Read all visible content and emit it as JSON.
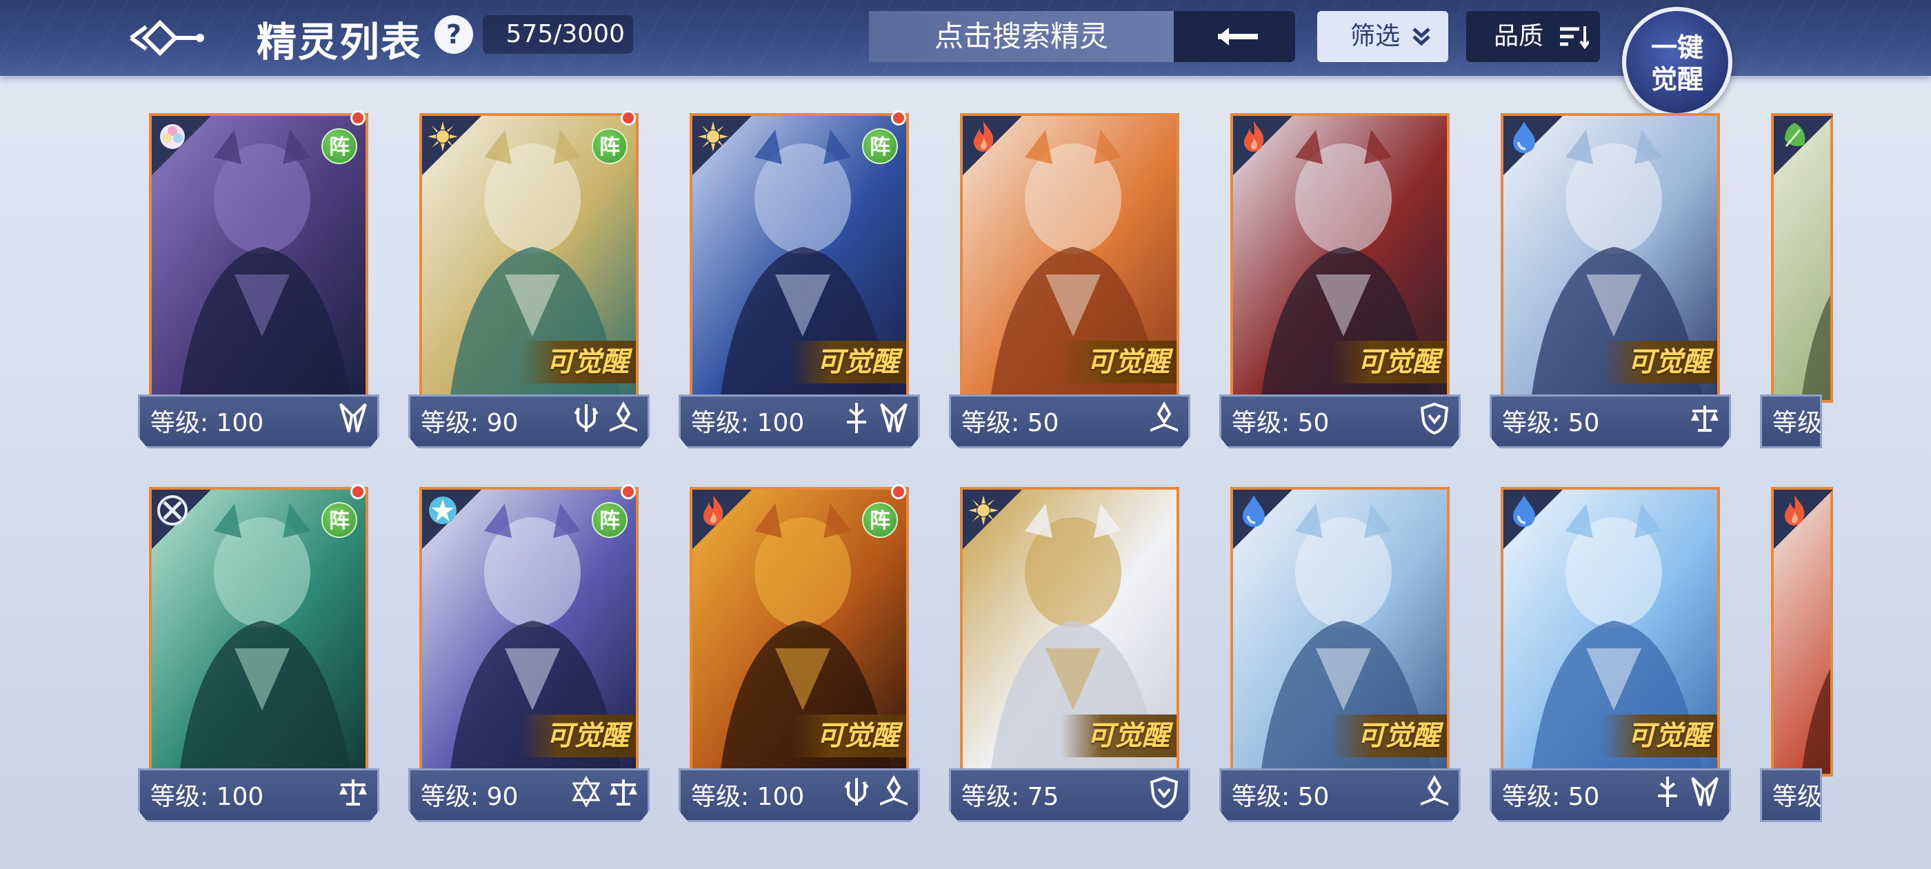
{
  "header": {
    "title": "精灵列表",
    "help_label": "?",
    "count": "575/3000",
    "search_placeholder": "点击搜索精灵",
    "filter_label": "筛选",
    "quality_label": "品质",
    "awaken_line1": "一键",
    "awaken_line2": "觉醒"
  },
  "cards": [
    {
      "level": "等级: 100",
      "element": "light-prism-icon",
      "team_badge": "阵",
      "awakenable": "",
      "alert": true,
      "classes": [
        "fang-icon"
      ],
      "palette": [
        "#1b1f3f",
        "#4b3b7a",
        "#8a7cc4"
      ]
    },
    {
      "level": "等级: 90",
      "element": "sun-icon",
      "team_badge": "阵",
      "awakenable": "可觉醒",
      "alert": true,
      "classes": [
        "trident-shield-icon",
        "book-icon"
      ],
      "palette": [
        "#2f6f6a",
        "#c9b36a",
        "#f2efe2"
      ]
    },
    {
      "level": "等级: 100",
      "element": "sun-icon",
      "team_badge": "阵",
      "awakenable": "可觉醒",
      "alert": true,
      "classes": [
        "sword-icon",
        "fang-icon"
      ],
      "palette": [
        "#1a2046",
        "#2e4fa0",
        "#c9d6f2"
      ]
    },
    {
      "level": "等级: 50",
      "element": "fire-icon",
      "team_badge": "",
      "awakenable": "可觉醒",
      "alert": false,
      "classes": [
        "book-icon"
      ],
      "palette": [
        "#8a3a1a",
        "#e07a3a",
        "#f4e2d2"
      ]
    },
    {
      "level": "等级: 50",
      "element": "fire-icon",
      "team_badge": "",
      "awakenable": "可觉醒",
      "alert": false,
      "classes": [
        "shield-icon"
      ],
      "palette": [
        "#2a1e2e",
        "#8b2a2a",
        "#e6e2ec"
      ]
    },
    {
      "level": "等级: 50",
      "element": "water-icon",
      "team_badge": "",
      "awakenable": "可觉醒",
      "alert": false,
      "classes": [
        "balance-icon"
      ],
      "palette": [
        "#2a3a6a",
        "#9ab6d8",
        "#eef3f9"
      ]
    },
    {
      "level": "等级",
      "element": "leaf-icon",
      "team_badge": "",
      "awakenable": "",
      "alert": false,
      "classes": [],
      "palette": [
        "#4a5a3a",
        "#a8b88a",
        "#e8ecd8"
      ]
    },
    {
      "level": "等级: 100",
      "element": "wind-icon",
      "team_badge": "阵",
      "awakenable": "",
      "alert": true,
      "classes": [
        "balance-icon"
      ],
      "palette": [
        "#143a38",
        "#2e8a74",
        "#b6e2d2"
      ]
    },
    {
      "level": "等级: 90",
      "element": "star-ring-icon",
      "team_badge": "阵",
      "awakenable": "可觉醒",
      "alert": true,
      "classes": [
        "hexagram-icon",
        "balance-icon"
      ],
      "palette": [
        "#1e2248",
        "#5a5ab0",
        "#e4e6f4"
      ]
    },
    {
      "level": "等级: 100",
      "element": "fire-icon",
      "team_badge": "阵",
      "awakenable": "可觉醒",
      "alert": true,
      "classes": [
        "trident-shield-icon",
        "book-icon"
      ],
      "palette": [
        "#2a140a",
        "#b8581a",
        "#f0b23a"
      ]
    },
    {
      "level": "等级: 75",
      "element": "sun-icon",
      "team_badge": "",
      "awakenable": "可觉醒",
      "alert": false,
      "classes": [
        "shield-icon"
      ],
      "palette": [
        "#c8ccd8",
        "#f0f2f6",
        "#c9a24a"
      ]
    },
    {
      "level": "等级: 50",
      "element": "water-icon",
      "team_badge": "",
      "awakenable": "可觉醒",
      "alert": false,
      "classes": [
        "book-icon"
      ],
      "palette": [
        "#3a5a8a",
        "#9ac0e4",
        "#eef4fa"
      ]
    },
    {
      "level": "等级: 50",
      "element": "water-icon",
      "team_badge": "",
      "awakenable": "可觉醒",
      "alert": false,
      "classes": [
        "sword-icon",
        "fang-icon"
      ],
      "palette": [
        "#3a6ab0",
        "#8cc0ee",
        "#f0f6fc"
      ]
    },
    {
      "level": "等级",
      "element": "fire-icon",
      "team_badge": "",
      "awakenable": "",
      "alert": false,
      "classes": [],
      "palette": [
        "#5a1e12",
        "#c8503a",
        "#f4e8e0"
      ]
    }
  ],
  "colors": {
    "card_border": "#e8883a",
    "level_bar": "#3b4d7c",
    "alert_dot": "#e84a3a",
    "team_badge": "#3d9b35",
    "awaken_text": "#ffd760"
  }
}
